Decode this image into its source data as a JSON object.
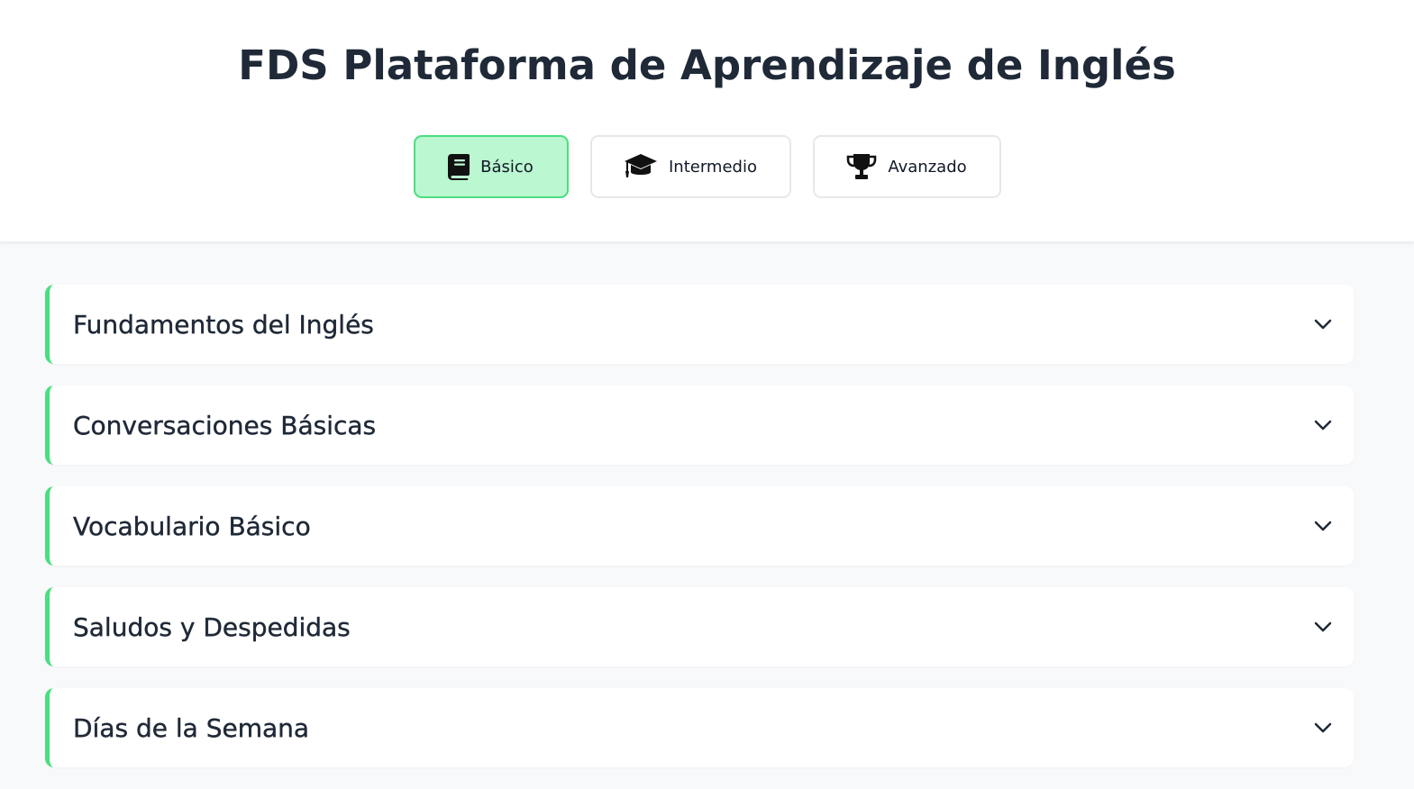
{
  "header": {
    "title": "FDS Plataforma de Aprendizaje de Inglés"
  },
  "levels": [
    {
      "label": "Básico",
      "icon": "book-icon",
      "active": true
    },
    {
      "label": "Intermedio",
      "icon": "graduation-cap-icon",
      "active": false
    },
    {
      "label": "Avanzado",
      "icon": "trophy-icon",
      "active": false
    }
  ],
  "modules": [
    {
      "title": "Fundamentos del Inglés",
      "icon": "chevron-down-icon"
    },
    {
      "title": "Conversaciones Básicas",
      "icon": "chevron-down-icon"
    },
    {
      "title": "Vocabulario Básico",
      "icon": "chevron-down-icon"
    },
    {
      "title": "Saludos y Despedidas",
      "icon": "chevron-down-icon"
    },
    {
      "title": "Días de la Semana",
      "icon": "chevron-down-icon"
    }
  ],
  "colors": {
    "accent": "#4ade80",
    "active_tab_bg": "#bbf7d0",
    "title_text": "#1f2937",
    "page_bg": "#f8f9fa"
  }
}
